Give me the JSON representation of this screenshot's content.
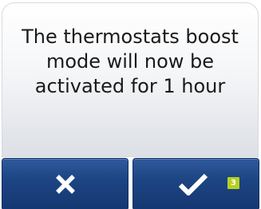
{
  "dialog": {
    "message": "The thermostats boost mode will now be activated for 1 hour"
  },
  "buttons": {
    "cancel": {
      "icon": "close-icon"
    },
    "confirm": {
      "icon": "checkmark-icon",
      "badge": "3"
    }
  },
  "colors": {
    "button_blue": "#1d4584",
    "badge_green": "#b5d020",
    "text": "#1a1a1a"
  }
}
